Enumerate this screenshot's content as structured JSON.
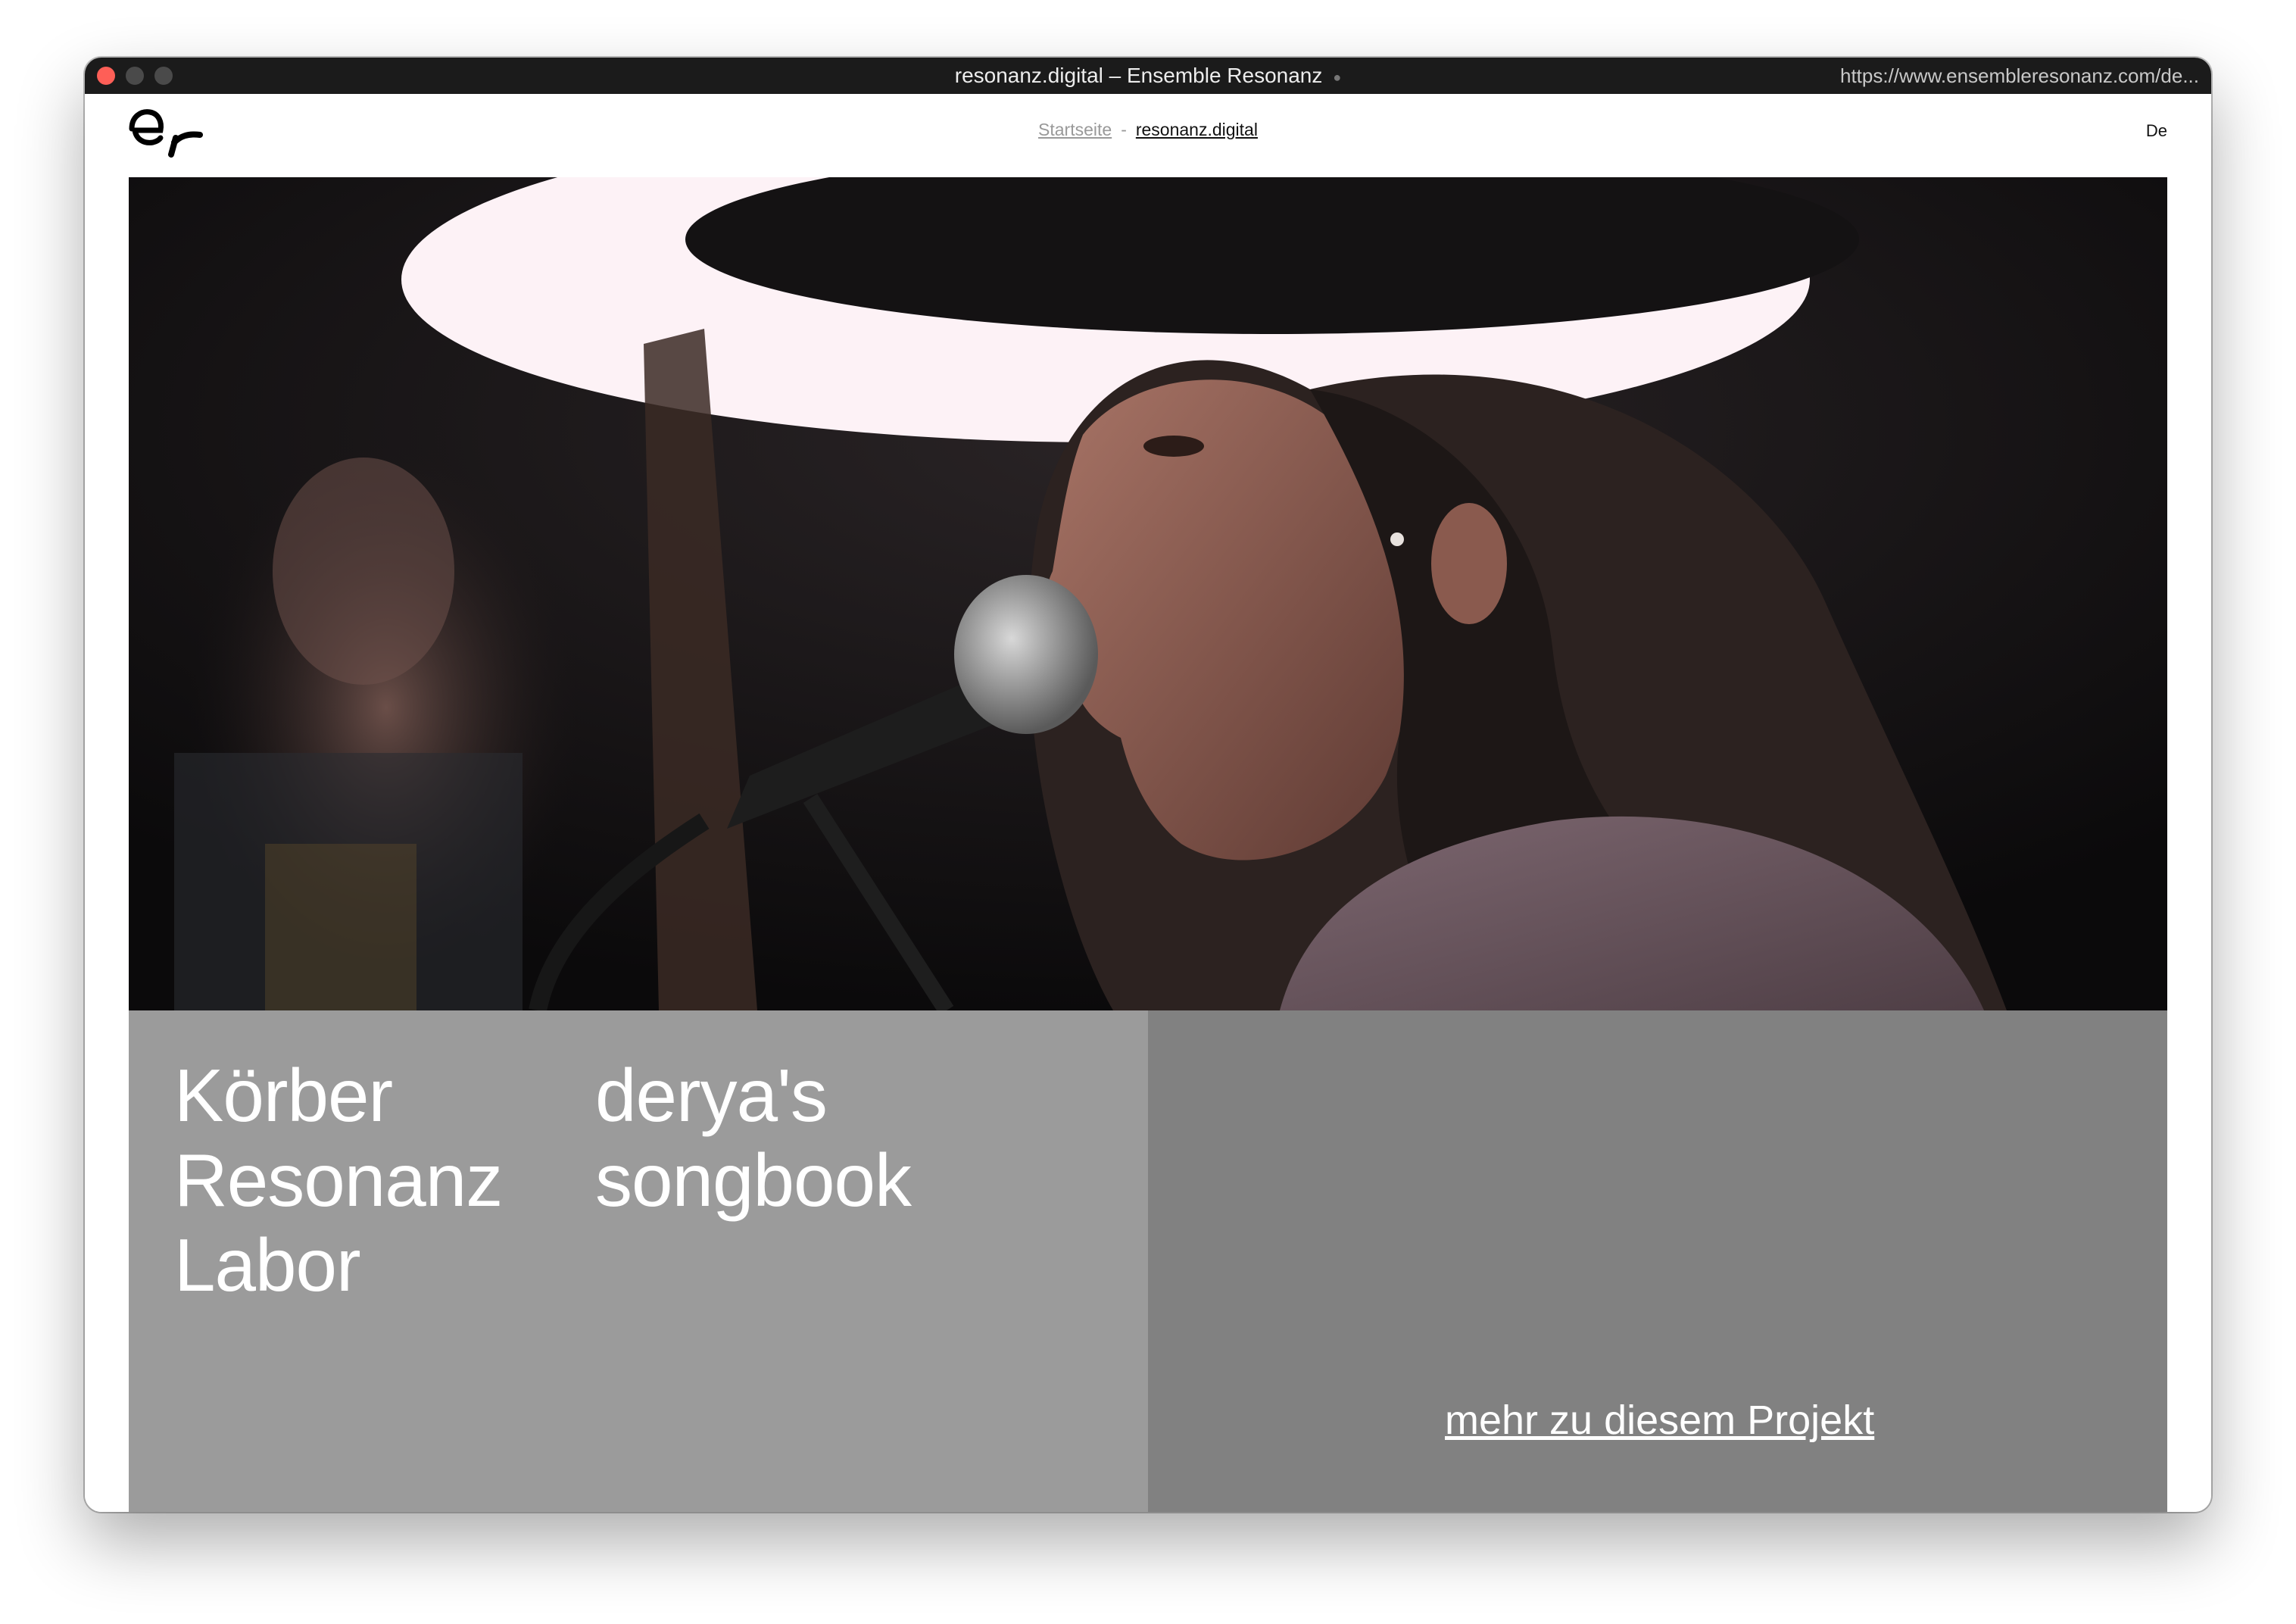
{
  "window": {
    "title": "resonanz.digital – Ensemble Resonanz",
    "url": "https://www.ensembleresonanz.com/de..."
  },
  "header": {
    "logo_icon": "er-logo-icon",
    "breadcrumb": {
      "home": "Startseite",
      "separator": "-",
      "current": "resonanz.digital"
    },
    "language": "De"
  },
  "hero": {
    "image": "singer-at-microphone-under-ring-light-photo"
  },
  "project": {
    "title_lines_a": [
      "Körber",
      "Resonanz",
      "Labor"
    ],
    "title_lines_b": [
      "derya's",
      "songbook"
    ],
    "more_link": "mehr zu diesem Projekt",
    "colors": {
      "left_panel": "#9b9b9b",
      "right_panel": "#818181"
    }
  }
}
